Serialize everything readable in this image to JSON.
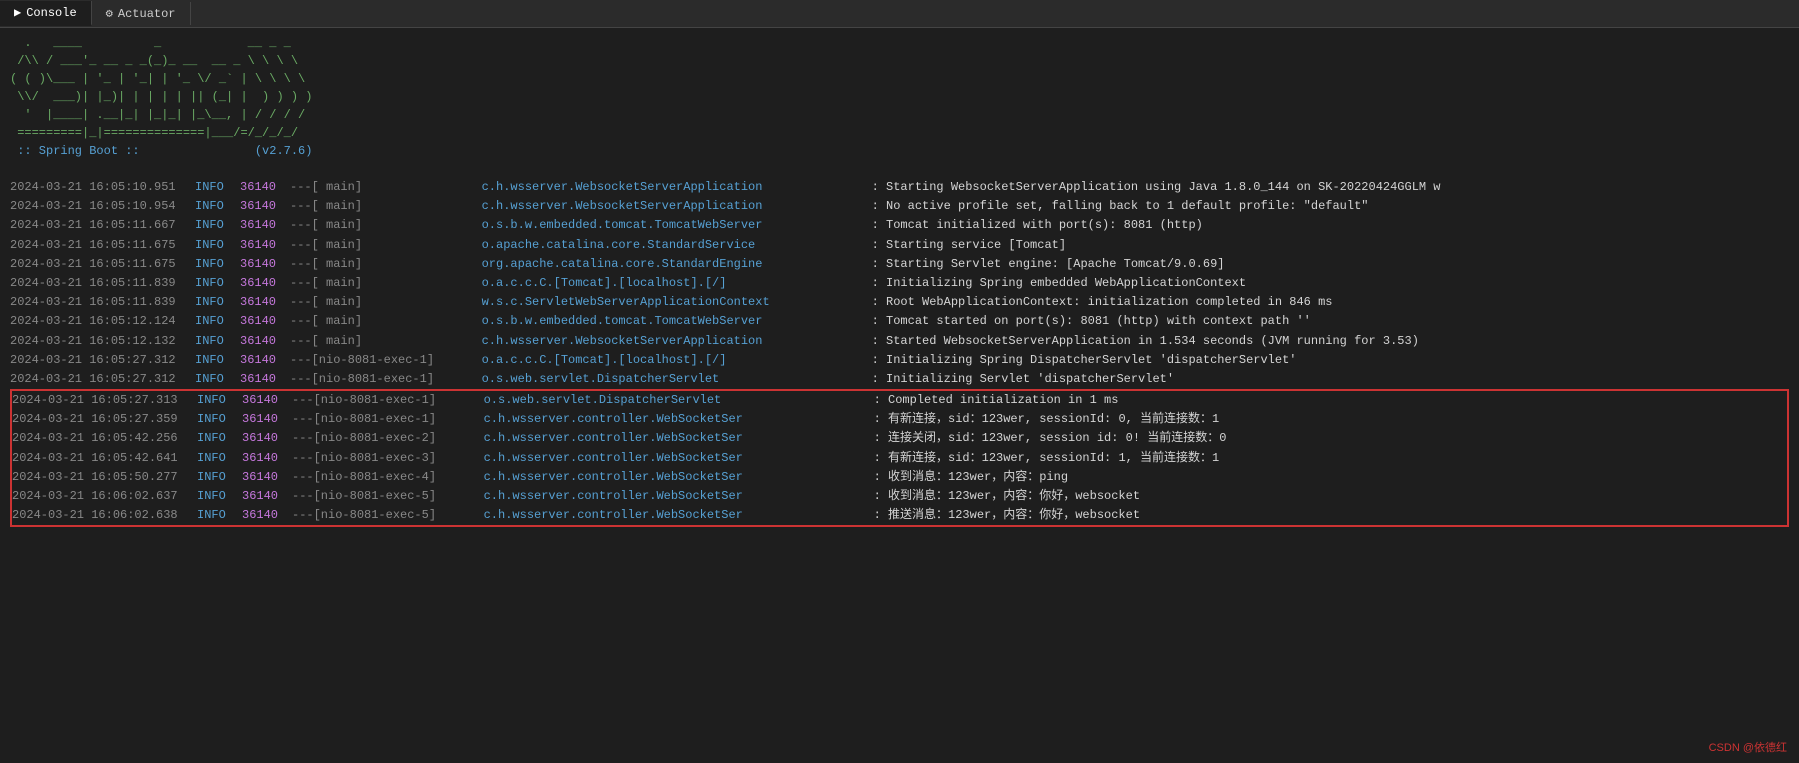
{
  "tabs": [
    {
      "id": "console",
      "label": "Console",
      "active": true,
      "icon": ""
    },
    {
      "id": "actuator",
      "label": "Actuator",
      "active": false,
      "icon": "⚙"
    }
  ],
  "banner": {
    "lines": [
      "  .   ____          _            __ _ _",
      " /\\\\ / ___'_ __ _ _(_)_ __  __ _ \\ \\ \\ \\",
      "( ( )\\___ | '_ | '_| | '_ \\/ _` | \\ \\ \\ \\",
      " \\\\/  ___)| |_)| | | | | || (_| |  ) ) ) )",
      "  '  |____| .__|_| |_|_| |_\\__, | / / / /",
      " =========|_|==============|___/=/_/_/_/"
    ],
    "version_line": " :: Spring Boot ::                (v2.7.6)"
  },
  "logs": [
    {
      "timestamp": "2024-03-21 16:05:10.951",
      "level": "INFO",
      "pid": "36140",
      "sep": "---",
      "thread": "[           main]",
      "class": "c.h.wsserver.WebsocketServerApplication",
      "message": ": Starting WebsocketServerApplication using Java 1.8.0_144 on SK-20220424GGLM w",
      "highlight": false
    },
    {
      "timestamp": "2024-03-21 16:05:10.954",
      "level": "INFO",
      "pid": "36140",
      "sep": "---",
      "thread": "[           main]",
      "class": "c.h.wsserver.WebsocketServerApplication",
      "message": ": No active profile set, falling back to 1 default profile: \"default\"",
      "highlight": false
    },
    {
      "timestamp": "2024-03-21 16:05:11.667",
      "level": "INFO",
      "pid": "36140",
      "sep": "---",
      "thread": "[           main]",
      "class": "o.s.b.w.embedded.tomcat.TomcatWebServer",
      "message": ": Tomcat initialized with port(s): 8081 (http)",
      "highlight": false
    },
    {
      "timestamp": "2024-03-21 16:05:11.675",
      "level": "INFO",
      "pid": "36140",
      "sep": "---",
      "thread": "[           main]",
      "class": "o.apache.catalina.core.StandardService",
      "message": ": Starting service [Tomcat]",
      "highlight": false
    },
    {
      "timestamp": "2024-03-21 16:05:11.675",
      "level": "INFO",
      "pid": "36140",
      "sep": "---",
      "thread": "[           main]",
      "class": "org.apache.catalina.core.StandardEngine",
      "message": ": Starting Servlet engine: [Apache Tomcat/9.0.69]",
      "highlight": false
    },
    {
      "timestamp": "2024-03-21 16:05:11.839",
      "level": "INFO",
      "pid": "36140",
      "sep": "---",
      "thread": "[           main]",
      "class": "o.a.c.c.C.[Tomcat].[localhost].[/]",
      "message": ": Initializing Spring embedded WebApplicationContext",
      "highlight": false
    },
    {
      "timestamp": "2024-03-21 16:05:11.839",
      "level": "INFO",
      "pid": "36140",
      "sep": "---",
      "thread": "[           main]",
      "class": "w.s.c.ServletWebServerApplicationContext",
      "message": ": Root WebApplicationContext: initialization completed in 846 ms",
      "highlight": false
    },
    {
      "timestamp": "2024-03-21 16:05:12.124",
      "level": "INFO",
      "pid": "36140",
      "sep": "---",
      "thread": "[           main]",
      "class": "o.s.b.w.embedded.tomcat.TomcatWebServer",
      "message": ": Tomcat started on port(s): 8081 (http) with context path ''",
      "highlight": false
    },
    {
      "timestamp": "2024-03-21 16:05:12.132",
      "level": "INFO",
      "pid": "36140",
      "sep": "---",
      "thread": "[           main]",
      "class": "c.h.wsserver.WebsocketServerApplication",
      "message": ": Started WebsocketServerApplication in 1.534 seconds (JVM running for 3.53)",
      "highlight": false
    },
    {
      "timestamp": "2024-03-21 16:05:27.312",
      "level": "INFO",
      "pid": "36140",
      "sep": "---",
      "thread": "[nio-8081-exec-1]",
      "class": "o.a.c.c.C.[Tomcat].[localhost].[/]",
      "message": ": Initializing Spring DispatcherServlet 'dispatcherServlet'",
      "highlight": false
    },
    {
      "timestamp": "2024-03-21 16:05:27.312",
      "level": "INFO",
      "pid": "36140",
      "sep": "---",
      "thread": "[nio-8081-exec-1]",
      "class": "o.s.web.servlet.DispatcherServlet",
      "message": ": Initializing Servlet 'dispatcherServlet'",
      "highlight": false
    },
    {
      "timestamp": "2024-03-21 16:05:27.313",
      "level": "INFO",
      "pid": "36140",
      "sep": "---",
      "thread": "[nio-8081-exec-1]",
      "class": "o.s.web.servlet.DispatcherServlet",
      "message": ": Completed initialization in 1 ms",
      "highlight": true,
      "highlight_start": true
    },
    {
      "timestamp": "2024-03-21 16:05:27.359",
      "level": "INFO",
      "pid": "36140",
      "sep": "---",
      "thread": "[nio-8081-exec-1]",
      "class": "c.h.wsserver.controller.WebSocketSer",
      "message": ": 有新连接，sid：123wer, sessionId: 0, 当前连接数：1",
      "highlight": true
    },
    {
      "timestamp": "2024-03-21 16:05:42.256",
      "level": "INFO",
      "pid": "36140",
      "sep": "---",
      "thread": "[nio-8081-exec-2]",
      "class": "c.h.wsserver.controller.WebSocketSer",
      "message": ": 连接关闭，sid：123wer, session id: 0! 当前连接数：0",
      "highlight": true
    },
    {
      "timestamp": "2024-03-21 16:05:42.641",
      "level": "INFO",
      "pid": "36140",
      "sep": "---",
      "thread": "[nio-8081-exec-3]",
      "class": "c.h.wsserver.controller.WebSocketSer",
      "message": ": 有新连接，sid：123wer, sessionId: 1, 当前连接数：1",
      "highlight": true
    },
    {
      "timestamp": "2024-03-21 16:05:50.277",
      "level": "INFO",
      "pid": "36140",
      "sep": "---",
      "thread": "[nio-8081-exec-4]",
      "class": "c.h.wsserver.controller.WebSocketSer",
      "message": ": 收到消息：123wer，内容：ping",
      "highlight": true
    },
    {
      "timestamp": "2024-03-21 16:06:02.637",
      "level": "INFO",
      "pid": "36140",
      "sep": "---",
      "thread": "[nio-8081-exec-5]",
      "class": "c.h.wsserver.controller.WebSocketSer",
      "message": ": 收到消息：123wer，内容：你好，websocket",
      "highlight": true
    },
    {
      "timestamp": "2024-03-21 16:06:02.638",
      "level": "INFO",
      "pid": "36140",
      "sep": "---",
      "thread": "[nio-8081-exec-5]",
      "class": "c.h.wsserver.controller.WebSocketSer",
      "message": ": 推送消息：123wer，内容：你好，websocket",
      "highlight": true,
      "highlight_end": true
    }
  ],
  "watermark": "CSDN @依德红"
}
